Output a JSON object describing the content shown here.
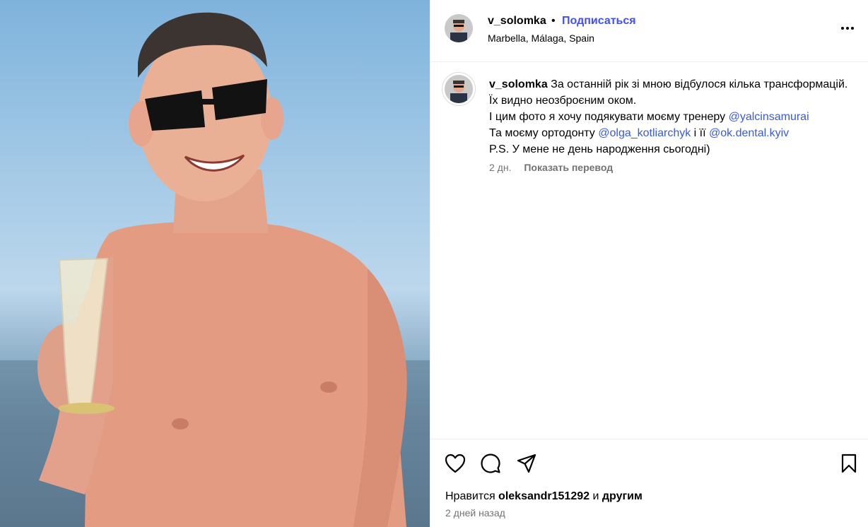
{
  "post": {
    "username": "v_solomka",
    "separator": "•",
    "follow_label": "Подписаться",
    "location": "Marbella, Málaga, Spain"
  },
  "caption": {
    "username": "v_solomka",
    "line1": "За останній рік зі мною відбулося кілька трансформацій. Їх видно неозброєним оком.",
    "line2_prefix": "І цим фото я хочу подякувати моєму тренеру ",
    "mention_trainer": "@yalcinsamurai",
    "line3_prefix": "Та моєму ортодонту ",
    "mention_ortho": "@olga_kotliarchyk",
    "line3_mid": " і її ",
    "mention_clinic": "@ok.dental.kyiv",
    "line4": "P.S. У мене не день народження сьогодні)",
    "age": "2 дн.",
    "translate_label": "Показать перевод"
  },
  "footer": {
    "likes_prefix": "Нравится ",
    "likes_user": "oleksandr151292",
    "likes_mid": " и ",
    "likes_others": "другим",
    "date": "2 дней назад"
  },
  "icons": [
    "like-icon",
    "comment-icon",
    "share-icon",
    "save-icon",
    "more-options-icon"
  ],
  "colors": {
    "accent": "#4150f7",
    "link": "#3a5bd9",
    "muted": "#737373"
  }
}
